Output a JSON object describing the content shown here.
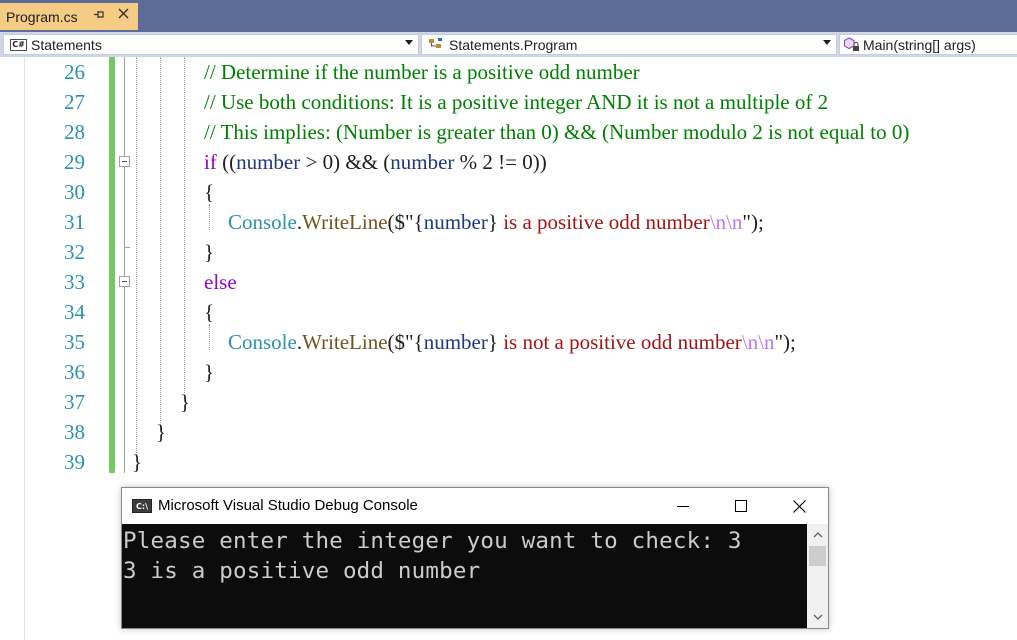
{
  "tab": {
    "title": "Program.cs",
    "pin_icon": "pin-icon",
    "close_icon": "close-icon",
    "bg": "#f5cc84"
  },
  "nav": {
    "project": "Statements",
    "type": "Statements.Program",
    "member": "Main(string[] args)",
    "project_icon": "csharp-icon",
    "type_icon": "class-icon",
    "member_icon": "method-icon"
  },
  "editor": {
    "line_numbers": [
      "26",
      "27",
      "28",
      "29",
      "30",
      "31",
      "32",
      "33",
      "34",
      "35",
      "36",
      "37",
      "38",
      "39"
    ],
    "lines": [
      {
        "num": "26",
        "tokens": [
          {
            "t": "// Determine if the number is a positive odd number",
            "c": "comment"
          }
        ]
      },
      {
        "num": "27",
        "tokens": [
          {
            "t": "// Use both conditions: It is a positive integer AND it is not a multiple of 2",
            "c": "comment"
          }
        ]
      },
      {
        "num": "28",
        "tokens": [
          {
            "t": "// This implies: (Number is greater than 0) && (Number modulo 2 is not equal to 0)",
            "c": "comment"
          }
        ]
      },
      {
        "num": "29",
        "tokens": [
          {
            "t": "if",
            "c": "kw"
          },
          {
            "t": " ((",
            "c": "plain"
          },
          {
            "t": "number",
            "c": "var"
          },
          {
            "t": " > 0) && (",
            "c": "plain"
          },
          {
            "t": "number",
            "c": "var"
          },
          {
            "t": " % 2 != 0))",
            "c": "plain"
          }
        ]
      },
      {
        "num": "30",
        "tokens": [
          {
            "t": "{",
            "c": "plain"
          }
        ]
      },
      {
        "num": "31",
        "tokens": [
          {
            "t": "Console",
            "c": "type"
          },
          {
            "t": ".",
            "c": "plain"
          },
          {
            "t": "WriteLine",
            "c": "method"
          },
          {
            "t": "($\"",
            "c": "plain"
          },
          {
            "t": "{",
            "c": "plain"
          },
          {
            "t": "number",
            "c": "var"
          },
          {
            "t": "}",
            "c": "plain"
          },
          {
            "t": " is a positive odd number",
            "c": "str"
          },
          {
            "t": "\\n\\n",
            "c": "esc"
          },
          {
            "t": "\");",
            "c": "plain"
          }
        ]
      },
      {
        "num": "32",
        "tokens": [
          {
            "t": "}",
            "c": "plain"
          }
        ]
      },
      {
        "num": "33",
        "tokens": [
          {
            "t": "else",
            "c": "kw"
          }
        ]
      },
      {
        "num": "34",
        "tokens": [
          {
            "t": "{",
            "c": "plain"
          }
        ]
      },
      {
        "num": "35",
        "tokens": [
          {
            "t": "Console",
            "c": "type"
          },
          {
            "t": ".",
            "c": "plain"
          },
          {
            "t": "WriteLine",
            "c": "method"
          },
          {
            "t": "($\"",
            "c": "plain"
          },
          {
            "t": "{",
            "c": "plain"
          },
          {
            "t": "number",
            "c": "var"
          },
          {
            "t": "}",
            "c": "plain"
          },
          {
            "t": " is not a positive odd number",
            "c": "str"
          },
          {
            "t": "\\n\\n",
            "c": "esc"
          },
          {
            "t": "\");",
            "c": "plain"
          }
        ]
      },
      {
        "num": "36",
        "tokens": [
          {
            "t": "}",
            "c": "plain"
          }
        ]
      },
      {
        "num": "37",
        "tokens": [
          {
            "t": "}",
            "c": "plain"
          }
        ]
      },
      {
        "num": "38",
        "tokens": [
          {
            "t": "}",
            "c": "plain"
          }
        ]
      },
      {
        "num": "39",
        "tokens": [
          {
            "t": "}",
            "c": "plain"
          }
        ]
      }
    ],
    "colors": {
      "comment": "#008000",
      "keyword": "#8f08c4",
      "variable": "#1f377f",
      "type": "#2b91af",
      "method": "#74531f",
      "string": "#a31515",
      "escape": "#b776fb",
      "line_number": "#2b91af",
      "change_bar": "#6ecb5d"
    }
  },
  "console": {
    "title": "Microsoft Visual Studio Debug Console",
    "app_icon": "console-app-icon",
    "minimize_icon": "minimize-icon",
    "maximize_icon": "maximize-icon",
    "close_icon": "close-icon",
    "output": [
      "Please enter the integer you want to check: 3",
      "3 is a positive odd number"
    ],
    "scroll_up_icon": "chevron-up-icon",
    "scroll_down_icon": "chevron-down-icon"
  }
}
